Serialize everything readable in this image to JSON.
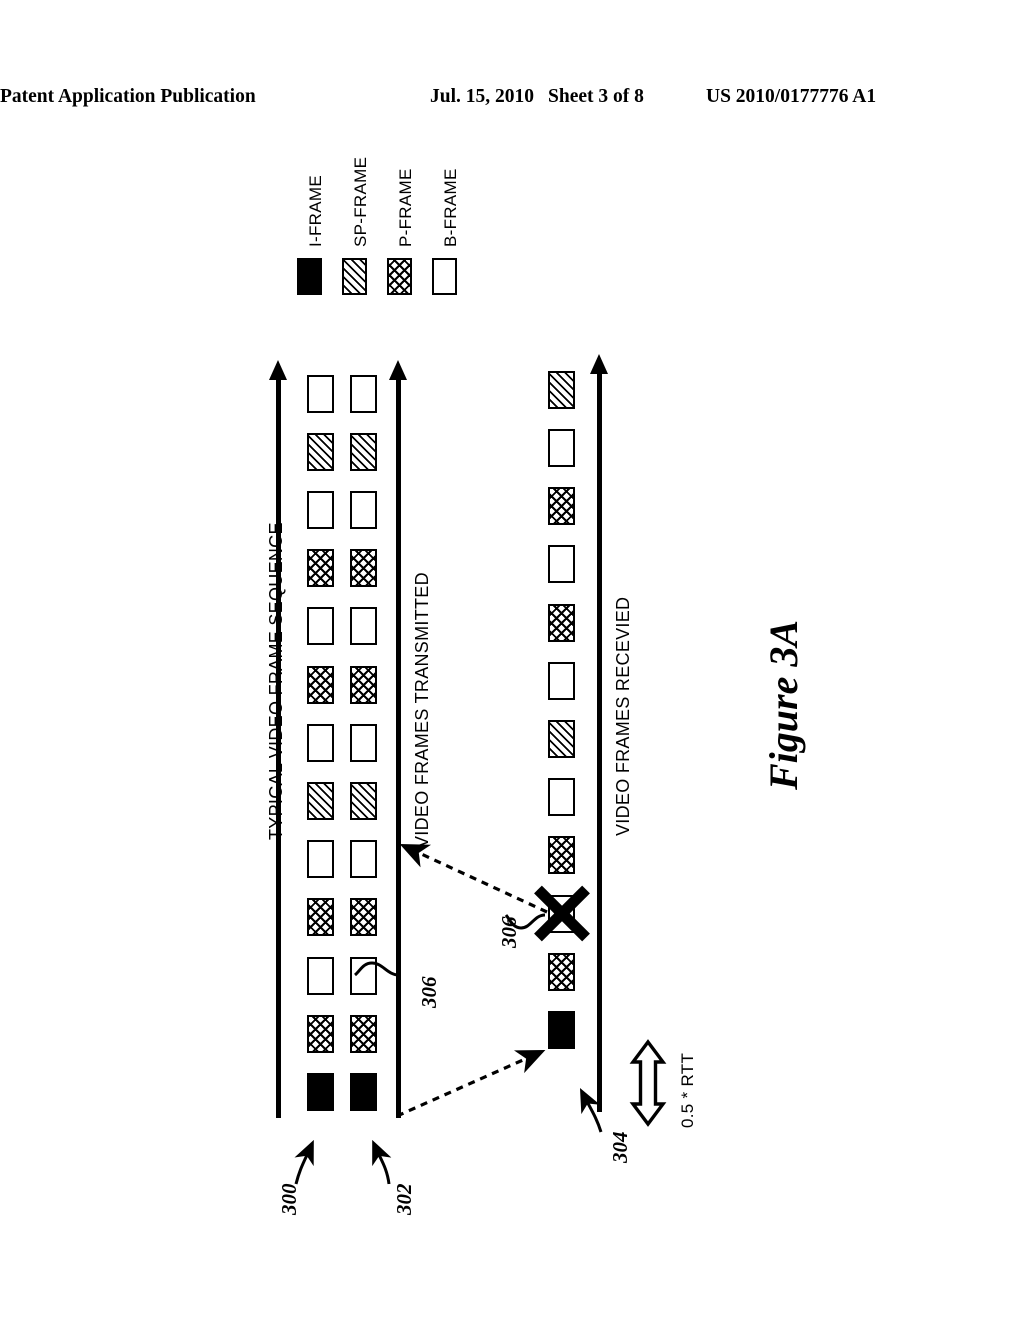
{
  "header": {
    "title": "Patent Application Publication",
    "date": "Jul. 15, 2010",
    "sheet": "Sheet 3 of 8",
    "publication_number": "US 2010/0177776 A1"
  },
  "figure": {
    "caption": "Figure 3A"
  },
  "legend": {
    "items": [
      {
        "label": "I-FRAME",
        "fill": "solid-black"
      },
      {
        "label": "SP-FRAME",
        "fill": "diagonal-hatch"
      },
      {
        "label": "P-FRAME",
        "fill": "cross-hatch"
      },
      {
        "label": "B-FRAME",
        "fill": "empty-white"
      }
    ]
  },
  "axes": [
    {
      "id": "typical",
      "label": "TYPICAL VIDEO FRAME SEQUENCE"
    },
    {
      "id": "transmitted",
      "label": "VIDEO FRAMES TRANSMITTED"
    },
    {
      "id": "received",
      "label": "VIDEO FRAMES RECEVIED"
    }
  ],
  "sequences": {
    "typical": {
      "axis_label": "TYPICAL VIDEO FRAME SEQUENCE",
      "frames": [
        "I",
        "P",
        "B",
        "P",
        "B",
        "SP",
        "B",
        "P",
        "B",
        "P",
        "B",
        "SP",
        "B"
      ]
    },
    "transmitted": {
      "axis_label": "VIDEO FRAMES TRANSMITTED",
      "frames": [
        "I",
        "P",
        "B",
        "P",
        "B",
        "SP",
        "B",
        "P",
        "B",
        "P",
        "B",
        "SP",
        "B"
      ]
    },
    "received": {
      "axis_label": "VIDEO FRAMES RECEVIED",
      "frames": [
        "I",
        "P",
        "LOST",
        "P",
        "B",
        "SP",
        "B",
        "P",
        "B",
        "P",
        "B",
        "SP"
      ]
    }
  },
  "annotations": {
    "ref_300": "300",
    "ref_302": "302",
    "ref_304": "304",
    "ref_306_transmitted": "306",
    "ref_306_received": "306",
    "rtt_label": "0.5 * RTT"
  },
  "colors": {
    "ink": "#000000",
    "paper": "#ffffff"
  }
}
